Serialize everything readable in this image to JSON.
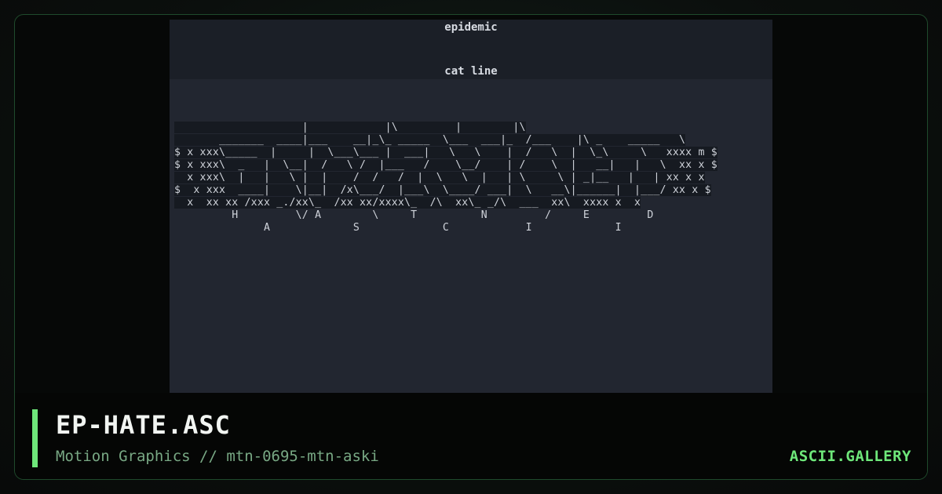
{
  "screen": {
    "header_text": "epidemic",
    "subheader_text": "cat line",
    "ascii_lines": [
      "                    |            |\\         |        |\\",
      "       _______  ____|___    __|_\\_ _____  \\___  ___|_  /___    |\\ _    _____   \\",
      "$ x xxx\\_____  |     |  \\___\\___ |  ___|   \\   \\    |  /   \\  |  \\_\\     \\   xxxx m $",
      "$ x xxx\\  _   |  \\__|  /   \\ /  |___   /    \\__/    | /    \\  |   __|   |   \\  xx x $",
      "  x xxx\\  |   |   \\ |  |    /  /   /  |  \\   \\  |   | \\     \\ | _|__   |   | xx x x",
      "$  x xxx  ____|    \\|__|  /x\\___/  |___\\  \\____/ ___|  \\   __\\|______|  |___/ xx x $",
      "  x  xx xx /xxx _./xx\\_  /xx xx/xxxx\\_  /\\  xx\\_ _/\\  ___  xx\\  xxxx x  x",
      "         H         \\/ A        \\     T          N         /     E         D",
      "              A             S             C            I             I"
    ]
  },
  "caption": {
    "title": "EP-HATE.ASC",
    "subtitle": "Motion Graphics // mtn-0695-mtn-aski",
    "brand": "ASCII.GALLERY"
  },
  "colors": {
    "accent": "#6ee77a",
    "screen_bg": "#222630",
    "card_border": "#1f4a2c"
  }
}
